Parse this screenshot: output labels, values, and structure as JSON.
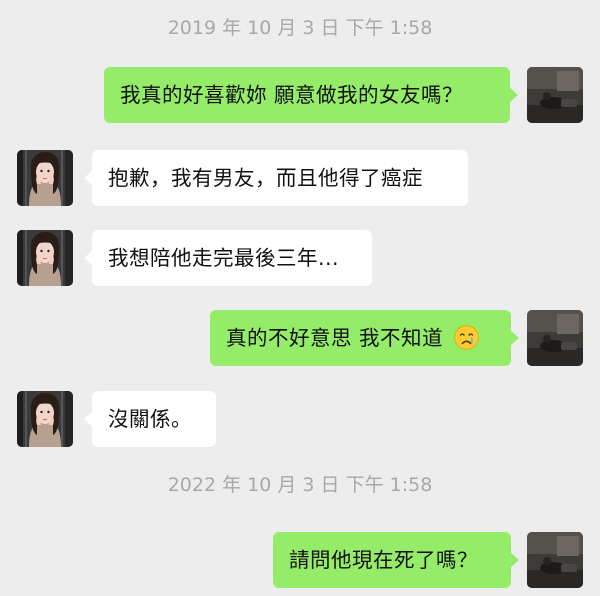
{
  "chat": {
    "timestamp_1": "2019 年 10 月 3 日 下午 1:58",
    "timestamp_2": "2022 年 10 月 3 日 下午 1:58",
    "messages": [
      {
        "sender": "me",
        "text": "我真的好喜歡妳 願意做我的女友嗎？"
      },
      {
        "sender": "other",
        "text": "抱歉，我有男友，而且他得了癌症"
      },
      {
        "sender": "other",
        "text": "我想陪他走完最後三年..."
      },
      {
        "sender": "me",
        "text": "真的不好意思 我不知道",
        "emoji": "crying-face-emoji"
      },
      {
        "sender": "other",
        "text": "沒關係。"
      },
      {
        "sender": "me",
        "text": "請問他現在死了嗎？"
      }
    ]
  },
  "colors": {
    "background": "#ededed",
    "outgoing_bubble": "#95ec69",
    "incoming_bubble": "#ffffff",
    "timestamp_text": "#a8a8a8"
  },
  "icons": {
    "my_avatar": "dark-room-photo-avatar",
    "contact_avatar": "woman-portrait-avatar",
    "emoji": "crying-face-emoji"
  }
}
